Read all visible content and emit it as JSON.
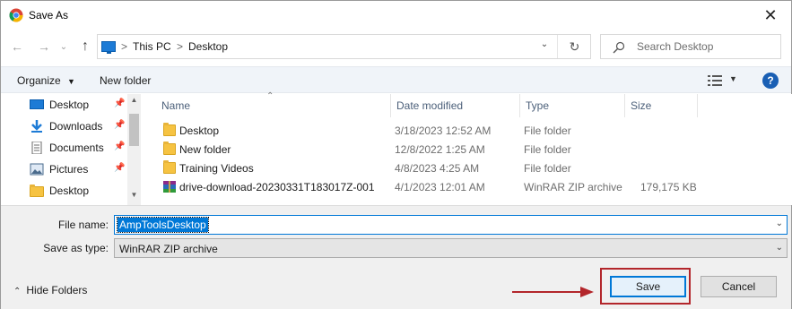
{
  "window": {
    "title": "Save As",
    "close_label": "✕"
  },
  "address": {
    "crumbs": [
      "This PC",
      "Desktop"
    ],
    "separator": ">"
  },
  "search": {
    "placeholder": "Search Desktop"
  },
  "toolbar": {
    "organize_label": "Organize",
    "new_folder_label": "New folder",
    "help_label": "?"
  },
  "nav": {
    "items": [
      {
        "label": "Desktop",
        "icon": "desktop-icon",
        "pinned": true
      },
      {
        "label": "Downloads",
        "icon": "download-icon",
        "pinned": true
      },
      {
        "label": "Documents",
        "icon": "documents-icon",
        "pinned": true
      },
      {
        "label": "Pictures",
        "icon": "pictures-icon",
        "pinned": true
      },
      {
        "label": "Desktop",
        "icon": "folder-icon",
        "pinned": false
      }
    ]
  },
  "filelist": {
    "columns": [
      "Name",
      "Date modified",
      "Type",
      "Size"
    ],
    "rows": [
      {
        "name": "Desktop",
        "date": "3/18/2023 12:52 AM",
        "type": "File folder",
        "size": "",
        "icon": "folder-icon"
      },
      {
        "name": "New folder",
        "date": "12/8/2022 1:25 AM",
        "type": "File folder",
        "size": "",
        "icon": "folder-icon"
      },
      {
        "name": "Training Videos",
        "date": "4/8/2023 4:25 AM",
        "type": "File folder",
        "size": "",
        "icon": "folder-icon"
      },
      {
        "name": "drive-download-20230331T183017Z-001",
        "date": "4/1/2023 12:01 AM",
        "type": "WinRAR ZIP archive",
        "size": "179,175 KB",
        "icon": "winrar-archive-icon"
      }
    ]
  },
  "form": {
    "file_name_label": "File name:",
    "file_name_value": "AmpToolsDesktop",
    "save_type_label": "Save as type:",
    "save_type_value": "WinRAR ZIP archive",
    "hide_folders_label": "Hide Folders",
    "save_label": "Save",
    "cancel_label": "Cancel"
  },
  "colors": {
    "accent": "#0078d7",
    "highlight_box": "#b3262b",
    "folder": "#f6c342"
  }
}
